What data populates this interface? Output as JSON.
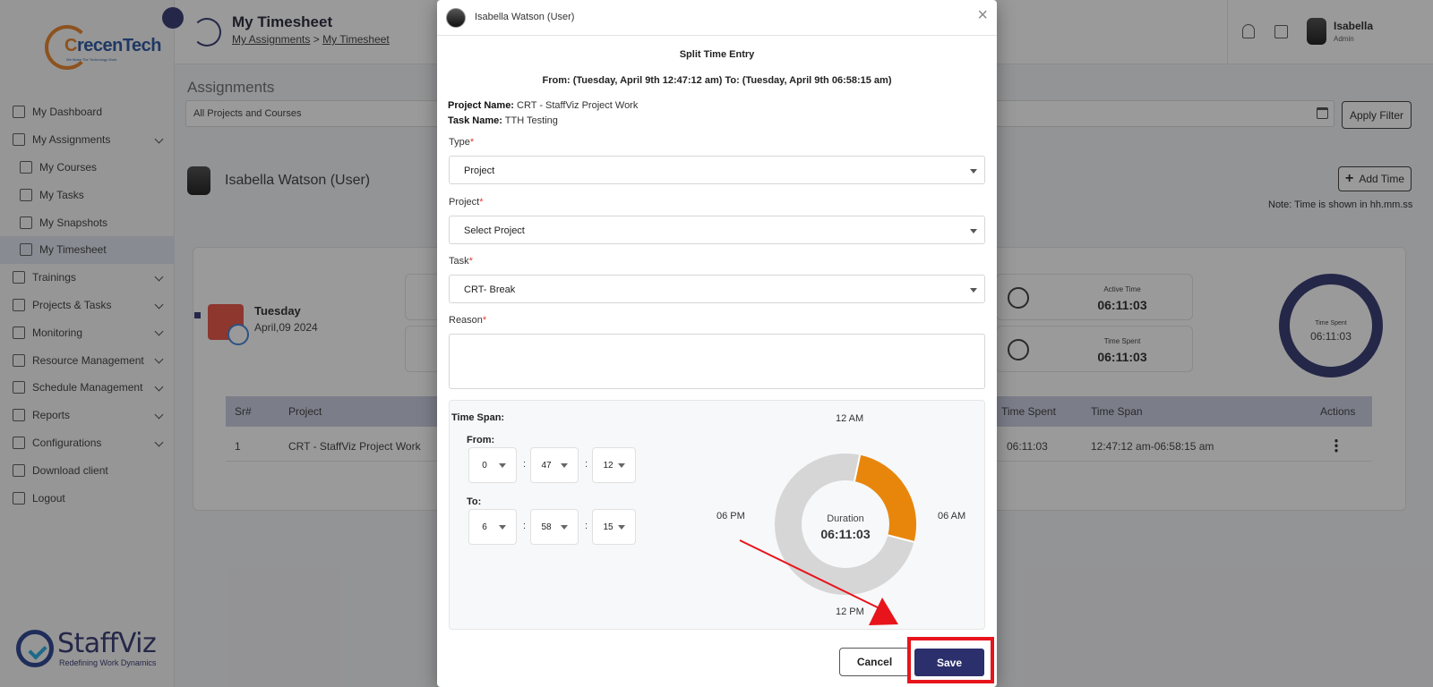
{
  "sidebar": {
    "brand_prefix": "C",
    "brand_text": "recenTech",
    "brand_tagline": "We Make The Technology Work",
    "items": [
      {
        "label": "My Dashboard",
        "icon": "dashboard-icon",
        "sub": false,
        "chevron": false,
        "active": false
      },
      {
        "label": "My Assignments",
        "icon": "assignments-icon",
        "sub": false,
        "chevron": true,
        "active": false
      },
      {
        "label": "My Courses",
        "icon": "courses-icon",
        "sub": true,
        "chevron": false,
        "active": false
      },
      {
        "label": "My Tasks",
        "icon": "tasks-icon",
        "sub": true,
        "chevron": false,
        "active": false
      },
      {
        "label": "My Snapshots",
        "icon": "snapshots-icon",
        "sub": true,
        "chevron": false,
        "active": false
      },
      {
        "label": "My Timesheet",
        "icon": "timesheet-icon",
        "sub": true,
        "chevron": false,
        "active": true
      },
      {
        "label": "Trainings",
        "icon": "trainings-icon",
        "sub": false,
        "chevron": true,
        "active": false
      },
      {
        "label": "Projects & Tasks",
        "icon": "projects-icon",
        "sub": false,
        "chevron": true,
        "active": false
      },
      {
        "label": "Monitoring",
        "icon": "monitoring-icon",
        "sub": false,
        "chevron": true,
        "active": false
      },
      {
        "label": "Resource Management",
        "icon": "resource-icon",
        "sub": false,
        "chevron": true,
        "active": false
      },
      {
        "label": "Schedule Management",
        "icon": "schedule-icon",
        "sub": false,
        "chevron": true,
        "active": false
      },
      {
        "label": "Reports",
        "icon": "reports-icon",
        "sub": false,
        "chevron": true,
        "active": false
      },
      {
        "label": "Configurations",
        "icon": "configurations-icon",
        "sub": false,
        "chevron": true,
        "active": false
      },
      {
        "label": "Download client",
        "icon": "download-icon",
        "sub": false,
        "chevron": false,
        "active": false
      },
      {
        "label": "Logout",
        "icon": "logout-icon",
        "sub": false,
        "chevron": false,
        "active": false
      }
    ],
    "footer_brand": "StaffViz",
    "footer_tagline": "Redefining Work Dynamics"
  },
  "header": {
    "title": "My Timesheet",
    "breadcrumb": [
      "My Assignments",
      "My Timesheet"
    ],
    "breadcrumb_sep": ">",
    "user_name": "Isabella",
    "user_role": "Admin"
  },
  "main": {
    "section_title": "Assignments",
    "filter_value": "All Projects and Courses",
    "apply_filter": "Apply Filter",
    "user_name": "Isabella Watson (User)",
    "add_time": "Add Time",
    "note": "Note: Time is shown in hh.mm.ss",
    "day": "Tuesday",
    "date": "April,09 2024",
    "active_time_label": "Active Time",
    "active_time_value": "06:11:03",
    "time_spent_label": "Time Spent",
    "time_spent_value": "06:11:03",
    "ring_label": "Time Spent",
    "ring_value": "06:11:03",
    "table": {
      "headers": {
        "sr": "Sr#",
        "project": "Project",
        "time_spent": "Time Spent",
        "time_span": "Time Span",
        "actions": "Actions"
      },
      "row": {
        "sr": "1",
        "project": "CRT - StaffViz Project Work",
        "time_spent": "06:11:03",
        "time_span": "12:47:12 am-06:58:15 am"
      }
    }
  },
  "modal": {
    "user": "Isabella Watson (User)",
    "close": "×",
    "title": "Split Time Entry",
    "range": "From: (Tuesday, April 9th 12:47:12 am) To: (Tuesday, April 9th 06:58:15 am)",
    "project_name_label": "Project Name:",
    "project_name": "CRT - StaffViz Project Work",
    "task_name_label": "Task Name:",
    "task_name": "TTH Testing",
    "required_mark": "*",
    "type_label": "Type",
    "type_value": "Project",
    "project_label": "Project",
    "project_value": "Select Project",
    "task_label": "Task",
    "task_value": "CRT- Break",
    "reason_label": "Reason",
    "reason_value": "",
    "time_span": {
      "title": "Time Span:",
      "from_label": "From:",
      "to_label": "To:",
      "from": {
        "h": "0",
        "m": "47",
        "s": "12"
      },
      "to": {
        "h": "6",
        "m": "58",
        "s": "15"
      },
      "colon": ":"
    },
    "clock": {
      "label_top": "12 AM",
      "label_right": "06 AM",
      "label_bottom": "12 PM",
      "label_left": "06 PM",
      "duration_label": "Duration",
      "duration_value": "06:11:03",
      "start_hour": 0.787,
      "end_hour": 6.971,
      "span_color": "#e8860c",
      "track_color": "#d6d6d6"
    },
    "cancel": "Cancel",
    "save": "Save"
  },
  "colors": {
    "primary": "#2b2f6b",
    "highlight": "#e8141c"
  }
}
